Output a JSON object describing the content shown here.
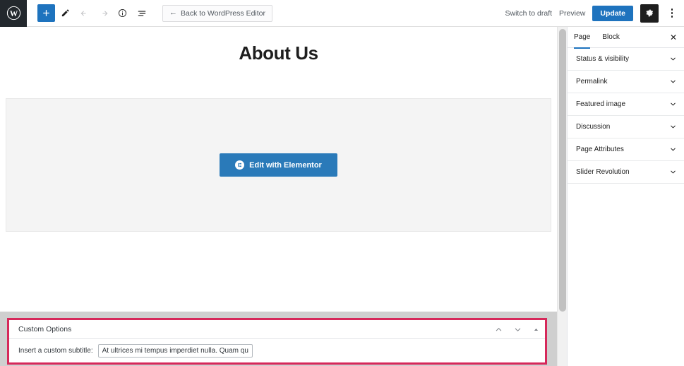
{
  "topbar": {
    "logo_icon": "wordpress-logo-icon",
    "tools": [
      {
        "name": "add-block-button",
        "icon": "plus-icon",
        "state": "primary"
      },
      {
        "name": "tools-button",
        "icon": "pencil-icon",
        "state": "default"
      },
      {
        "name": "undo-button",
        "icon": "undo-icon",
        "state": "disabled"
      },
      {
        "name": "redo-button",
        "icon": "redo-icon",
        "state": "disabled"
      },
      {
        "name": "details-button",
        "icon": "info-icon",
        "state": "default"
      },
      {
        "name": "list-view-button",
        "icon": "list-view-icon",
        "state": "default"
      }
    ],
    "back_button": {
      "arrow": "←",
      "label": "Back to WordPress Editor"
    },
    "switch_to_draft": "Switch to draft",
    "preview": "Preview",
    "update": "Update",
    "settings_icon": "gear-icon",
    "more_icon": "kebab-menu-icon",
    "accent_blue": "#1e73be"
  },
  "canvas": {
    "post_title": "About Us",
    "elementor": {
      "button_label": "Edit with Elementor",
      "logo_icon": "elementor-logo-icon",
      "button_color": "#2a7ab9",
      "panel_bg": "#f4f4f4"
    }
  },
  "metabox": {
    "title": "Custom Options",
    "border_color": "#d6285a",
    "controls": [
      {
        "name": "move-up-button",
        "icon": "chevron-up-icon"
      },
      {
        "name": "move-down-button",
        "icon": "chevron-down-icon"
      },
      {
        "name": "toggle-panel-button",
        "icon": "collapse-caret-icon"
      }
    ],
    "field": {
      "label": "Insert a custom subtitle:",
      "value": "At ultrices mi tempus imperdiet nulla. Quam quisque",
      "placeholder": ""
    }
  },
  "sidebar": {
    "tabs": [
      {
        "label": "Page",
        "active": true
      },
      {
        "label": "Block",
        "active": false
      }
    ],
    "close_icon": "close-icon",
    "close_label": "✕",
    "panels": [
      {
        "label": "Status & visibility",
        "icon": "chevron-down-icon"
      },
      {
        "label": "Permalink",
        "icon": "chevron-down-icon"
      },
      {
        "label": "Featured image",
        "icon": "chevron-down-icon"
      },
      {
        "label": "Discussion",
        "icon": "chevron-down-icon"
      },
      {
        "label": "Page Attributes",
        "icon": "chevron-down-icon"
      },
      {
        "label": "Slider Revolution",
        "icon": "chevron-down-icon"
      }
    ]
  }
}
